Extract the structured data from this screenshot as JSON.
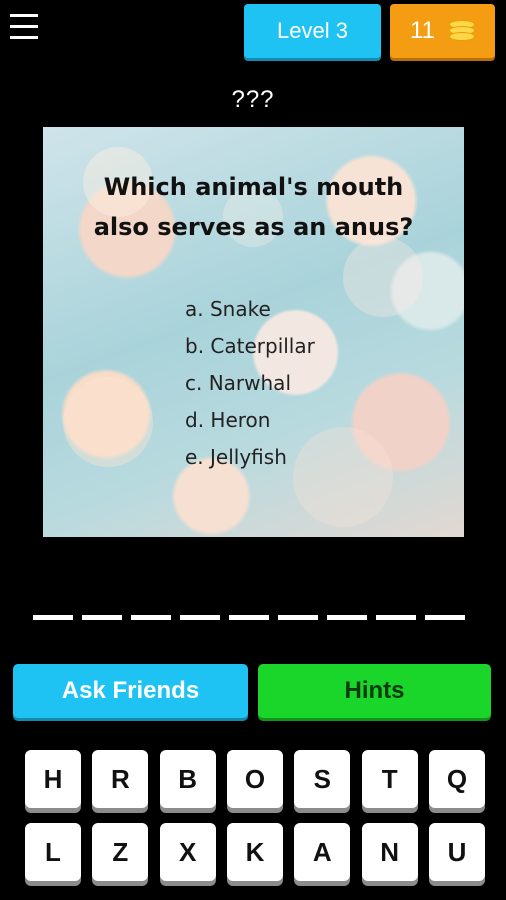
{
  "header": {
    "level_label": "Level 3",
    "coins": "11"
  },
  "answer_title": "???",
  "puzzle": {
    "question_line1": "Which animal's mouth",
    "question_line2": "also serves as an anus?",
    "options": [
      "a. Snake",
      "b. Caterpillar",
      "c. Narwhal",
      "d. Heron",
      "e. Jellyfish"
    ]
  },
  "answer_slots": 9,
  "actions": {
    "ask_label": "Ask Friends",
    "hints_label": "Hints"
  },
  "keyboard": {
    "row1": [
      "H",
      "R",
      "B",
      "O",
      "S",
      "T",
      "Q"
    ],
    "row2": [
      "L",
      "Z",
      "X",
      "K",
      "A",
      "N",
      "U"
    ]
  },
  "colors": {
    "level_button": "#1fc3f3",
    "coins_button": "#f49d13",
    "ask_button": "#1fc3f3",
    "hints_button": "#1bd62a"
  },
  "icons": {
    "menu": "hamburger-menu-icon",
    "coins": "coin-stack-icon"
  }
}
